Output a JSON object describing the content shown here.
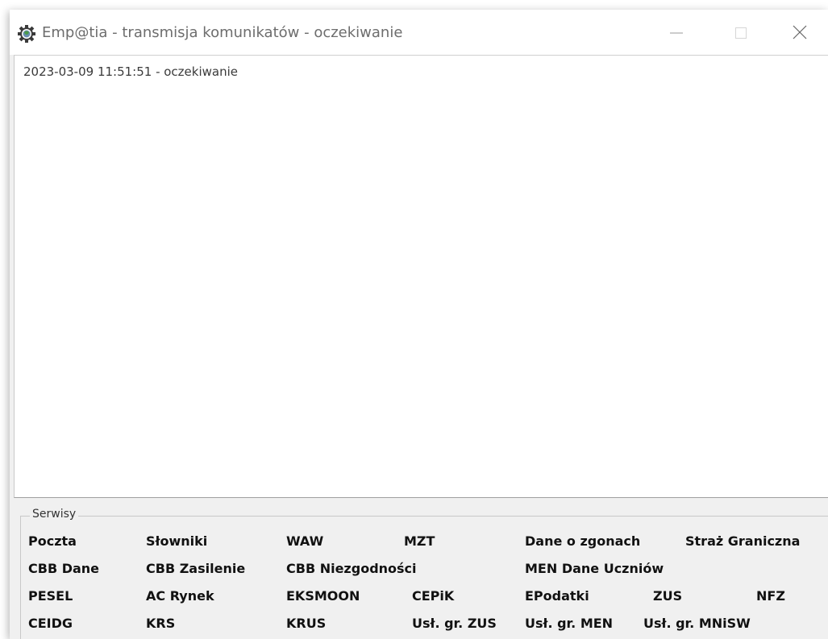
{
  "window": {
    "title": "Emp@tia - transmisja komunikatów - oczekiwanie"
  },
  "log": {
    "lines": [
      "2023-03-09 11:51:51 - oczekiwanie"
    ]
  },
  "services": {
    "group_label": "Serwisy",
    "rows": [
      [
        "Poczta",
        "Słowniki",
        "WAW",
        "MZT",
        "Dane o zgonach",
        "Straż Graniczna"
      ],
      [
        "CBB Dane",
        "CBB Zasilenie",
        "CBB Niezgodności",
        "MEN Dane Uczniów"
      ],
      [
        "PESEL",
        "AC Rynek",
        "EKSMOON",
        "CEPiK",
        "EPodatki",
        "ZUS",
        "NFZ"
      ],
      [
        "CEIDG",
        "KRS",
        "KRUS",
        "Usł. gr. ZUS",
        "Usł. gr. MEN",
        "Usł. gr. MNiSW"
      ]
    ]
  }
}
